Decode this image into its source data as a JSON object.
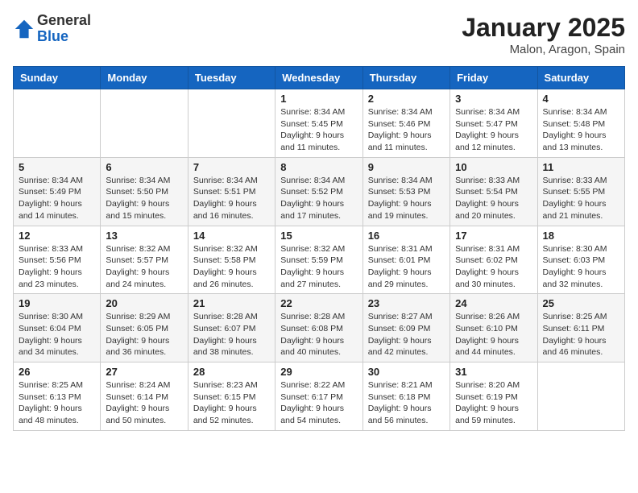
{
  "header": {
    "logo_general": "General",
    "logo_blue": "Blue",
    "month_title": "January 2025",
    "location": "Malon, Aragon, Spain"
  },
  "days_of_week": [
    "Sunday",
    "Monday",
    "Tuesday",
    "Wednesday",
    "Thursday",
    "Friday",
    "Saturday"
  ],
  "weeks": [
    [
      {
        "day": "",
        "info": ""
      },
      {
        "day": "",
        "info": ""
      },
      {
        "day": "",
        "info": ""
      },
      {
        "day": "1",
        "info": "Sunrise: 8:34 AM\nSunset: 5:45 PM\nDaylight: 9 hours\nand 11 minutes."
      },
      {
        "day": "2",
        "info": "Sunrise: 8:34 AM\nSunset: 5:46 PM\nDaylight: 9 hours\nand 11 minutes."
      },
      {
        "day": "3",
        "info": "Sunrise: 8:34 AM\nSunset: 5:47 PM\nDaylight: 9 hours\nand 12 minutes."
      },
      {
        "day": "4",
        "info": "Sunrise: 8:34 AM\nSunset: 5:48 PM\nDaylight: 9 hours\nand 13 minutes."
      }
    ],
    [
      {
        "day": "5",
        "info": "Sunrise: 8:34 AM\nSunset: 5:49 PM\nDaylight: 9 hours\nand 14 minutes."
      },
      {
        "day": "6",
        "info": "Sunrise: 8:34 AM\nSunset: 5:50 PM\nDaylight: 9 hours\nand 15 minutes."
      },
      {
        "day": "7",
        "info": "Sunrise: 8:34 AM\nSunset: 5:51 PM\nDaylight: 9 hours\nand 16 minutes."
      },
      {
        "day": "8",
        "info": "Sunrise: 8:34 AM\nSunset: 5:52 PM\nDaylight: 9 hours\nand 17 minutes."
      },
      {
        "day": "9",
        "info": "Sunrise: 8:34 AM\nSunset: 5:53 PM\nDaylight: 9 hours\nand 19 minutes."
      },
      {
        "day": "10",
        "info": "Sunrise: 8:33 AM\nSunset: 5:54 PM\nDaylight: 9 hours\nand 20 minutes."
      },
      {
        "day": "11",
        "info": "Sunrise: 8:33 AM\nSunset: 5:55 PM\nDaylight: 9 hours\nand 21 minutes."
      }
    ],
    [
      {
        "day": "12",
        "info": "Sunrise: 8:33 AM\nSunset: 5:56 PM\nDaylight: 9 hours\nand 23 minutes."
      },
      {
        "day": "13",
        "info": "Sunrise: 8:32 AM\nSunset: 5:57 PM\nDaylight: 9 hours\nand 24 minutes."
      },
      {
        "day": "14",
        "info": "Sunrise: 8:32 AM\nSunset: 5:58 PM\nDaylight: 9 hours\nand 26 minutes."
      },
      {
        "day": "15",
        "info": "Sunrise: 8:32 AM\nSunset: 5:59 PM\nDaylight: 9 hours\nand 27 minutes."
      },
      {
        "day": "16",
        "info": "Sunrise: 8:31 AM\nSunset: 6:01 PM\nDaylight: 9 hours\nand 29 minutes."
      },
      {
        "day": "17",
        "info": "Sunrise: 8:31 AM\nSunset: 6:02 PM\nDaylight: 9 hours\nand 30 minutes."
      },
      {
        "day": "18",
        "info": "Sunrise: 8:30 AM\nSunset: 6:03 PM\nDaylight: 9 hours\nand 32 minutes."
      }
    ],
    [
      {
        "day": "19",
        "info": "Sunrise: 8:30 AM\nSunset: 6:04 PM\nDaylight: 9 hours\nand 34 minutes."
      },
      {
        "day": "20",
        "info": "Sunrise: 8:29 AM\nSunset: 6:05 PM\nDaylight: 9 hours\nand 36 minutes."
      },
      {
        "day": "21",
        "info": "Sunrise: 8:28 AM\nSunset: 6:07 PM\nDaylight: 9 hours\nand 38 minutes."
      },
      {
        "day": "22",
        "info": "Sunrise: 8:28 AM\nSunset: 6:08 PM\nDaylight: 9 hours\nand 40 minutes."
      },
      {
        "day": "23",
        "info": "Sunrise: 8:27 AM\nSunset: 6:09 PM\nDaylight: 9 hours\nand 42 minutes."
      },
      {
        "day": "24",
        "info": "Sunrise: 8:26 AM\nSunset: 6:10 PM\nDaylight: 9 hours\nand 44 minutes."
      },
      {
        "day": "25",
        "info": "Sunrise: 8:25 AM\nSunset: 6:11 PM\nDaylight: 9 hours\nand 46 minutes."
      }
    ],
    [
      {
        "day": "26",
        "info": "Sunrise: 8:25 AM\nSunset: 6:13 PM\nDaylight: 9 hours\nand 48 minutes."
      },
      {
        "day": "27",
        "info": "Sunrise: 8:24 AM\nSunset: 6:14 PM\nDaylight: 9 hours\nand 50 minutes."
      },
      {
        "day": "28",
        "info": "Sunrise: 8:23 AM\nSunset: 6:15 PM\nDaylight: 9 hours\nand 52 minutes."
      },
      {
        "day": "29",
        "info": "Sunrise: 8:22 AM\nSunset: 6:17 PM\nDaylight: 9 hours\nand 54 minutes."
      },
      {
        "day": "30",
        "info": "Sunrise: 8:21 AM\nSunset: 6:18 PM\nDaylight: 9 hours\nand 56 minutes."
      },
      {
        "day": "31",
        "info": "Sunrise: 8:20 AM\nSunset: 6:19 PM\nDaylight: 9 hours\nand 59 minutes."
      },
      {
        "day": "",
        "info": ""
      }
    ]
  ]
}
